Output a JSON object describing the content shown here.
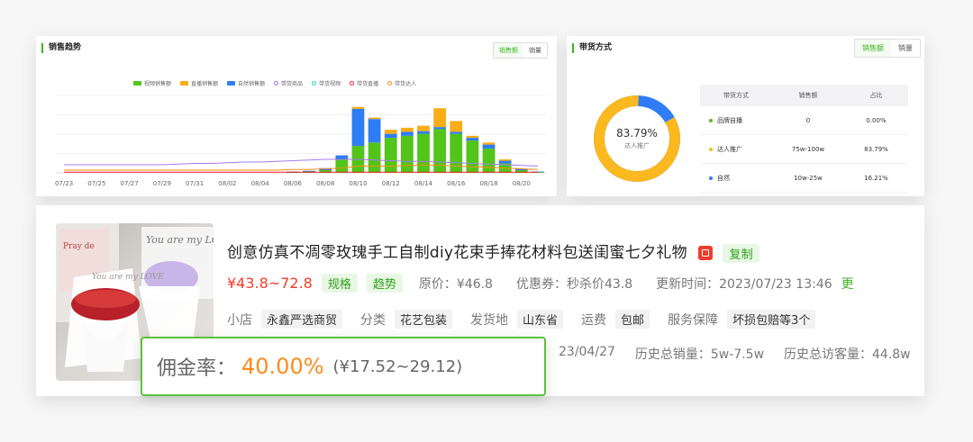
{
  "trend": {
    "title": "销售趋势",
    "toggle": [
      "销售额",
      "销量"
    ],
    "legend": [
      {
        "label": "视频销售额",
        "kind": "bar",
        "color": "#52c41a"
      },
      {
        "label": "直播销售额",
        "kind": "bar",
        "color": "#faad14"
      },
      {
        "label": "自然销售额",
        "kind": "bar",
        "color": "#2f7df6"
      },
      {
        "label": "带货商品",
        "kind": "line",
        "color": "#9b6cf2"
      },
      {
        "label": "带货视频",
        "kind": "line",
        "color": "#36cfc9"
      },
      {
        "label": "带货直播",
        "kind": "line",
        "color": "#f5222d"
      },
      {
        "label": "带货达人",
        "kind": "line",
        "color": "#fa8c16"
      }
    ]
  },
  "chart_data": {
    "type": "bar",
    "categories": [
      "07/23",
      "07/24",
      "07/25",
      "07/26",
      "07/27",
      "07/28",
      "07/29",
      "07/30",
      "07/31",
      "08/01",
      "08/02",
      "08/03",
      "08/04",
      "08/05",
      "08/06",
      "08/07",
      "08/08",
      "08/09",
      "08/10",
      "08/11",
      "08/12",
      "08/13",
      "08/14",
      "08/15",
      "08/16",
      "08/17",
      "08/18",
      "08/19",
      "08/20",
      "08/21"
    ],
    "x_tick_labels": [
      "07/23",
      "07/25",
      "07/27",
      "07/29",
      "07/31",
      "08/02",
      "08/04",
      "08/06",
      "08/08",
      "08/10",
      "08/12",
      "08/14",
      "08/16",
      "08/18",
      "08/20"
    ],
    "series": [
      {
        "name": "视频销售额",
        "values": [
          0,
          0,
          0,
          0,
          0,
          0,
          0,
          0,
          0,
          0,
          0,
          0,
          0,
          0,
          1,
          2,
          4,
          20,
          40,
          45,
          52,
          55,
          58,
          65,
          58,
          48,
          36,
          14,
          4,
          1
        ]
      },
      {
        "name": "直播销售额",
        "values": [
          0,
          0,
          0,
          0,
          0,
          0,
          0,
          0,
          0,
          0,
          0,
          0,
          0,
          0,
          0,
          0,
          0,
          0,
          3,
          2,
          6,
          6,
          8,
          28,
          16,
          3,
          3,
          2,
          0,
          0
        ]
      },
      {
        "name": "自然销售额",
        "values": [
          0,
          0,
          0,
          0,
          0,
          0,
          0,
          0,
          0,
          0,
          0,
          0,
          0,
          0,
          1,
          1,
          3,
          6,
          55,
          35,
          6,
          6,
          4,
          3,
          3,
          4,
          6,
          4,
          2,
          1
        ]
      },
      {
        "name": "带货商品",
        "values": [
          12,
          12,
          12,
          12,
          12,
          12,
          12,
          13,
          14,
          14,
          15,
          16,
          16,
          17,
          18,
          19,
          20,
          20,
          20,
          19,
          18,
          17,
          17,
          16,
          15,
          14,
          13,
          12,
          11,
          10
        ]
      },
      {
        "name": "带货直播",
        "values": [
          1,
          1,
          1,
          1,
          1,
          1,
          1,
          1,
          1,
          1,
          1,
          1,
          1,
          1,
          1,
          1,
          1,
          1,
          1,
          1,
          1,
          1,
          1,
          1,
          1,
          1,
          1,
          1,
          1,
          1
        ]
      },
      {
        "name": "带货达人",
        "values": [
          4,
          4,
          4,
          4,
          4,
          4,
          4,
          4,
          4,
          4,
          4,
          4,
          4,
          4,
          5,
          5,
          6,
          7,
          10,
          10,
          10,
          11,
          12,
          11,
          10,
          9,
          8,
          7,
          6,
          5
        ]
      }
    ]
  },
  "channel": {
    "title": "带货方式",
    "toggle": [
      "销售额",
      "销量"
    ],
    "donut": {
      "percent": "83.79%",
      "label": "达人推广",
      "share": 0.8379,
      "main_color": "#fbb91f",
      "rest_color": "#2f7df6"
    },
    "table": {
      "headers": [
        "带货方式",
        "销售额",
        "占比"
      ],
      "rows": [
        {
          "name": "品牌自播",
          "sales": "0",
          "ratio": "0.00%",
          "color": "#52c41a"
        },
        {
          "name": "达人推广",
          "sales": "75w-100w",
          "ratio": "83.79%",
          "color": "#fbb91f"
        },
        {
          "name": "自然",
          "sales": "10w-25w",
          "ratio": "16.21%",
          "color": "#2f7df6"
        }
      ]
    }
  },
  "product": {
    "title": "创意仿真不凋零玫瑰手工自制diy花束手捧花材料包送闺蜜七夕礼物",
    "copy_label": "复制",
    "price": "¥43.8~72.8",
    "spec_tag": "规格",
    "trend_tag": "趋势",
    "original_price": "原价：¥46.8",
    "coupon": "优惠券：秒杀价43.8",
    "updated": "更新时间：2023/07/23 13:46",
    "updated_cut": "更",
    "shop_label": "小店",
    "shop": "永鑫严选商贸",
    "category_label": "分类",
    "category": "花艺包装",
    "ship_label": "发货地",
    "ship": "山东省",
    "freight_label": "运费",
    "freight": "包邮",
    "service_label": "服务保障",
    "service": "坏损包赔等3个",
    "listed_partial": "23/04/27",
    "total_sales": "历史总销量：5w-7.5w",
    "total_visitors": "历史总访客量：44.8w",
    "image_text_1": "You are my LOVE",
    "image_text_2": "You are my LOVE",
    "image_text_3": "Pray de"
  },
  "commission": {
    "label": "佣金率：",
    "rate": "40.00%",
    "range": "(¥17.52~29.12)"
  }
}
